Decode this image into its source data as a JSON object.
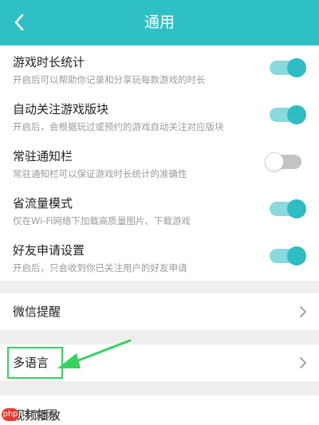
{
  "header": {
    "title": "通用"
  },
  "settings": [
    {
      "label": "游戏时长统计",
      "desc": "开启后可以帮助你记录和分享玩每款游戏的时长",
      "on": true
    },
    {
      "label": "自动关注游戏版块",
      "desc": "开启后，会根据玩过或预约的游戏自动关注对应版块",
      "on": true
    },
    {
      "label": "常驻通知栏",
      "desc": "常驻通知栏可以保证游戏时长统计的准确性",
      "on": false
    },
    {
      "label": "省流量模式",
      "desc": "仅在Wi-Fi网络下加载高质量图片、下载游戏",
      "on": true
    },
    {
      "label": "好友申请设置",
      "desc": "开启后，只会收到你已关注用户的好友申请",
      "on": true
    }
  ],
  "nav": [
    {
      "label": "微信提醒"
    },
    {
      "label": "多语言"
    },
    {
      "label": "视频播放"
    }
  ],
  "watermark": {
    "logo": "php",
    "text": "中文网"
  },
  "colors": {
    "accent": "#2fc0c6",
    "highlight": "#36d25f"
  }
}
